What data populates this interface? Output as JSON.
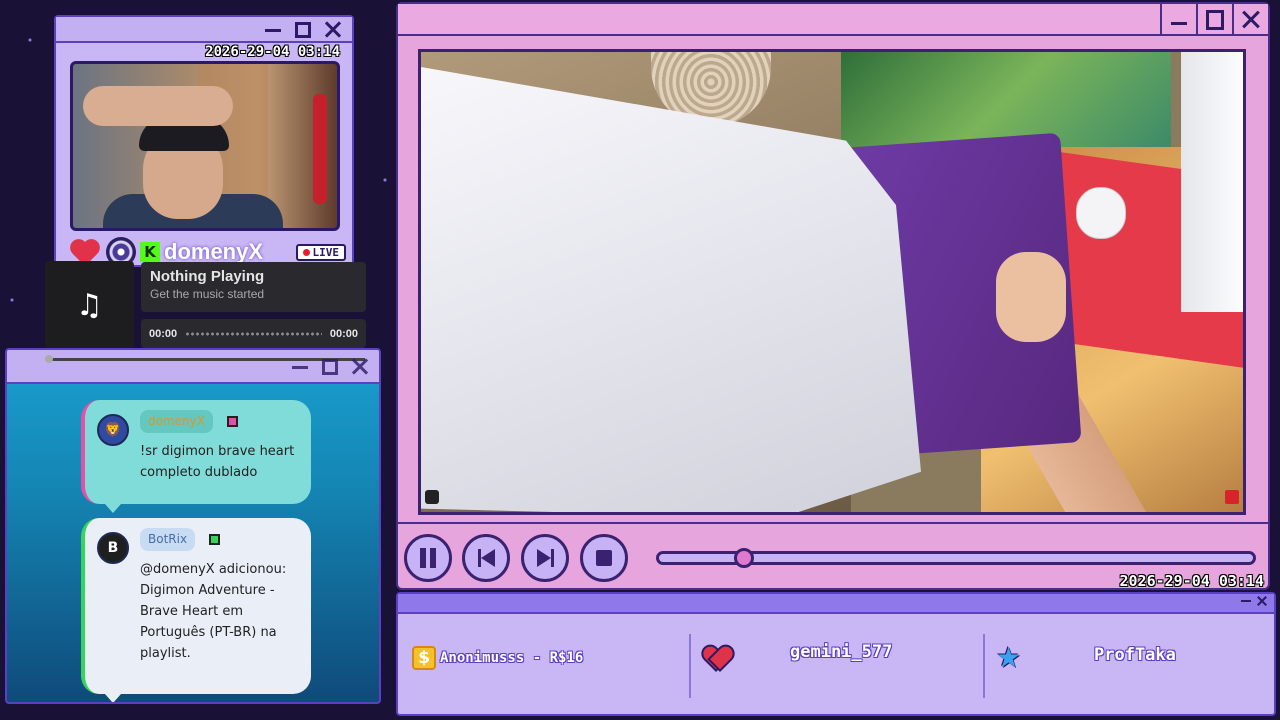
{
  "webcam": {
    "timestamp": "2026-29-04 03:14",
    "username": "domenyX",
    "live_label": "LIVE"
  },
  "music": {
    "icon": "music-note-icon",
    "title": "Nothing Playing",
    "subtitle": "Get the music started",
    "current_time": "00:00",
    "total_time": "00:00"
  },
  "chat": {
    "messages": [
      {
        "username": "domenyX",
        "text": "!sr digimon brave heart completo dublado",
        "avatar": "lion-avatar",
        "accent": "#e64fa6"
      },
      {
        "username": "BotRix",
        "text": "@domenyX adicionou: Digimon Adventure - Brave Heart em Português (PT-BR) na playlist.",
        "avatar": "botrix-avatar",
        "accent": "#37d35a"
      }
    ]
  },
  "player": {
    "timestamp": "2026-29-04 03:14",
    "progress": 0.13,
    "controls": {
      "pause": "pause-icon",
      "previous": "previous-icon",
      "next": "next-icon",
      "stop": "stop-icon"
    }
  },
  "events": {
    "donation": {
      "text": "Anonimusss - R$16",
      "icon": "dollar-icon"
    },
    "follower": {
      "text": "gemini_577",
      "icon": "heart-icon"
    },
    "subscriber": {
      "text": "ProfTaka",
      "icon": "star-icon"
    }
  },
  "colors": {
    "background": "#1a1236",
    "window_purple": "#c9b6f5",
    "player_pink": "#e6a5dc",
    "border": "#5b3fc4"
  }
}
